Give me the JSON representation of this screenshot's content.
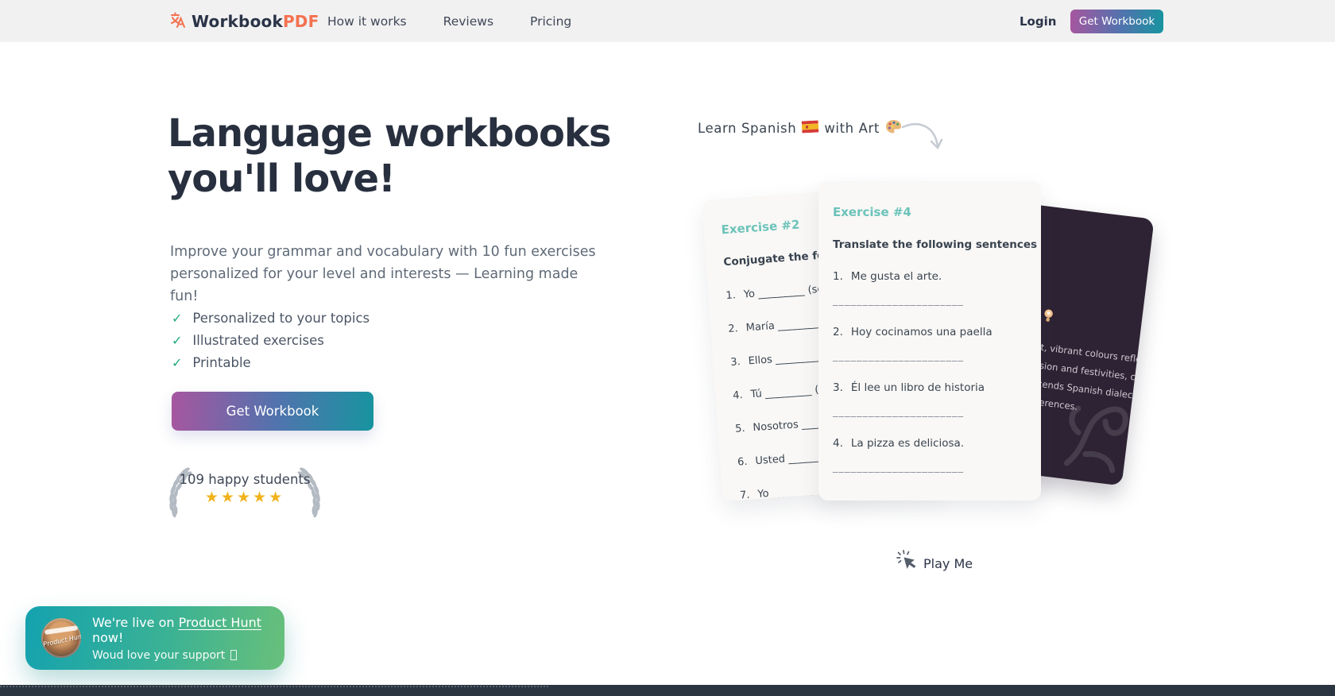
{
  "header": {
    "logo": {
      "text_primary": "Workbook",
      "text_accent": "PDF"
    },
    "nav": [
      {
        "label": "How it works"
      },
      {
        "label": "Reviews"
      },
      {
        "label": "Pricing"
      }
    ],
    "login_label": "Login",
    "cta_label": "Get Workbook"
  },
  "hero": {
    "title_line1": "Language workbooks",
    "title_line2": "you'll love!",
    "subtitle": "Improve your grammar and vocabulary with 10 fun exercises personalized for your level and interests — Learning made fun!",
    "checklist": [
      "Personalized to your topics",
      "Illustrated exercises",
      "Printable"
    ],
    "cta_label": "Get Workbook",
    "social_proof": {
      "text": "109 happy students",
      "stars": 5
    }
  },
  "annotation": {
    "text_before_flag": "Learn Spanish",
    "text_after_flag": "with Art"
  },
  "cards": {
    "left": {
      "heading": "Exercise #2",
      "instruction": "Conjugate the followin",
      "items": [
        "Yo _________ (ser) a",
        "María _________ (co",
        "Ellos _________ (es",
        "Tú _________ (dibu",
        "Nosotros _________",
        "Usted _________ (",
        "Yo _________ (lee"
      ]
    },
    "middle": {
      "heading": "Exercise #4",
      "instruction": "Translate the following sentences from Spanish",
      "items": [
        "Me gusta el arte.",
        "Hoy cocinamos una paella",
        "Él lee un libro de historia",
        "La pizza es deliciosa."
      ],
      "blank": "______________________"
    },
    "dark": {
      "lines": [
        "rt, vibrant colours reflect",
        "ssion and festivities, creating",
        "scends Spanish dialects and",
        "ifferences."
      ]
    }
  },
  "play_me": {
    "label": "Play Me"
  },
  "toast": {
    "line1_prefix": "We're live on ",
    "line1_link": "Product Hunt",
    "line1_suffix": " now!",
    "line2": "Woud love your support",
    "avatar_script": "Product Hunt"
  },
  "icons": {
    "check": "✓",
    "star": "★"
  },
  "colors": {
    "accent_coral": "#f4714f",
    "navy": "#28303f",
    "teal_heading": "#6cc3ba",
    "check_green": "#1fa97d",
    "star_gold": "#f1b31c",
    "button_gradient_start": "#a7569f",
    "button_gradient_end": "#17949f",
    "toast_gradient_start": "#14a2af",
    "toast_gradient_end": "#69c07a",
    "dark_card_bg": "#2d2334",
    "footer_bg": "#2b3542",
    "header_bg": "#f1f1f2"
  }
}
